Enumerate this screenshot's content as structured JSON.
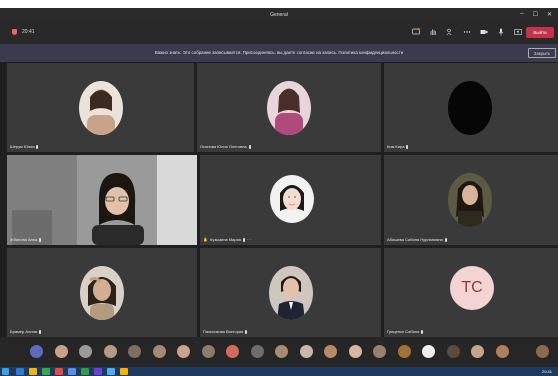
{
  "window": {
    "title": "General",
    "controls": [
      "–",
      "☐",
      "✕"
    ]
  },
  "meeting": {
    "timer": "20:41",
    "toolbar_icons": [
      "chat-icon",
      "raise-hand-icon",
      "people-icon",
      "more-icon",
      "camera-icon",
      "mic-icon",
      "share-icon"
    ],
    "leave_label": "Выйти"
  },
  "banner": {
    "message": "Важно знать: Это собрание записывается. Присоединяясь, вы даете согласие на запись. Политика конфиденциальности",
    "button_label": "Закрыть"
  },
  "participants": [
    {
      "name": "Шерум Юлия",
      "tile": "avatar",
      "color": "#c9a28a"
    },
    {
      "name": "Осипова Юлия Олеговна",
      "tile": "avatar",
      "color": "#b04a7a"
    },
    {
      "name": "Ким Кира",
      "tile": "avatar",
      "color": "#060606"
    },
    {
      "name": "Жбанова Анна",
      "tile": "video",
      "color": "#6f6f6f"
    },
    {
      "name": "Кузьмина Мария",
      "tile": "avatar",
      "color": "#e6e6e6",
      "hand": true
    },
    {
      "name": "Абишева Сабина Нурлановна",
      "tile": "avatar",
      "color": "#3b3224"
    },
    {
      "name": "Брамер Алина",
      "tile": "avatar",
      "color": "#b59b7e"
    },
    {
      "name": "Пальчикова Виктория",
      "tile": "avatar",
      "color": "#a17d6a"
    },
    {
      "name": "Гриценко Сабина",
      "tile": "initials",
      "initials": "TC"
    }
  ],
  "strip_colors": [
    "#5c6bc0",
    "#c7a18a",
    "#9a9a9a",
    "#b49b86",
    "#7d6f63",
    "#a08a78",
    "#caa28d",
    "#8d7b6b",
    "#d16c5a",
    "#6d6d6d",
    "#a98b74",
    "#c9b7a8",
    "#b88a6a",
    "#d7b79e",
    "#9a7f72",
    "#a4703c",
    "#efefef",
    "#5e4a3f",
    "#c3a48d",
    "#b07e59",
    "#8c6a52"
  ],
  "taskbar": {
    "clock": "20:41",
    "app_colors": [
      "#2d7dd2",
      "#f2b705",
      "#33a852",
      "#e24c3c",
      "#5b8def",
      "#2f9e44",
      "#6741d9",
      "#4dabf7",
      "#fab005"
    ]
  }
}
